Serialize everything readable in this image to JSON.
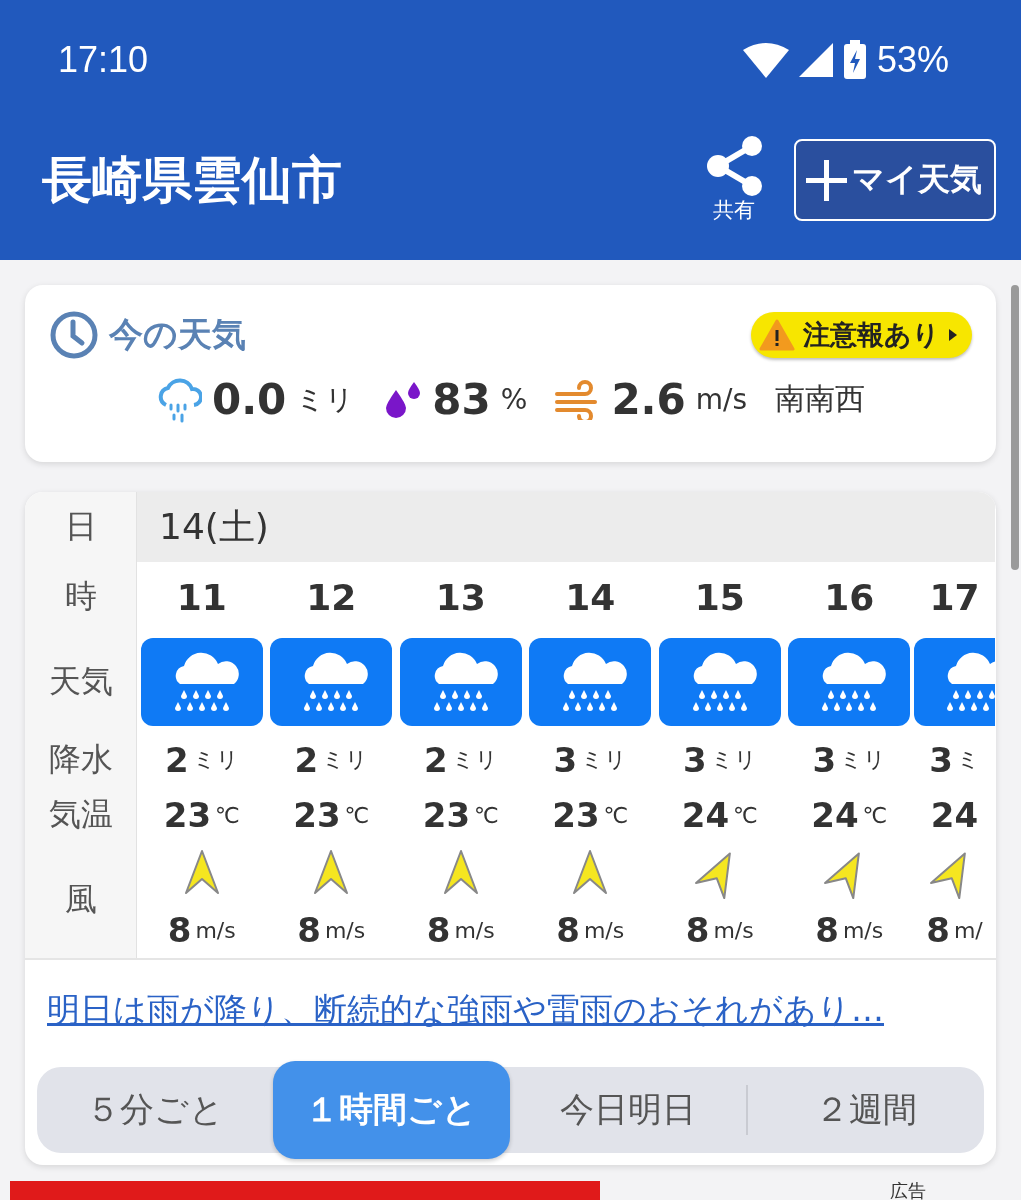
{
  "status_bar": {
    "time": "17:10",
    "battery": "53%"
  },
  "header": {
    "title": "長崎県雲仙市",
    "share_label": "共有",
    "my_weather_button": "マイ天気"
  },
  "current": {
    "title": "今の天気",
    "alert": "注意報あり",
    "precip": {
      "value": "0.0",
      "unit": "ミリ"
    },
    "humidity": {
      "value": "83",
      "unit": "%"
    },
    "wind": {
      "value": "2.6",
      "unit": "m/s",
      "direction": "南南西"
    }
  },
  "forecast": {
    "row_labels": [
      "日",
      "時",
      "天気",
      "降水",
      "気温",
      "風"
    ],
    "date": "14(土)",
    "hours": [
      {
        "hour": "11",
        "kind": "rain",
        "precip": "2",
        "precip_unit": "ミリ",
        "temp": "23",
        "temp_unit": "℃",
        "arrow_tilted": false,
        "wind": "8",
        "wind_unit": "m/s"
      },
      {
        "hour": "12",
        "kind": "rain",
        "precip": "2",
        "precip_unit": "ミリ",
        "temp": "23",
        "temp_unit": "℃",
        "arrow_tilted": false,
        "wind": "8",
        "wind_unit": "m/s"
      },
      {
        "hour": "13",
        "kind": "rain",
        "precip": "2",
        "precip_unit": "ミリ",
        "temp": "23",
        "temp_unit": "℃",
        "arrow_tilted": false,
        "wind": "8",
        "wind_unit": "m/s"
      },
      {
        "hour": "14",
        "kind": "rain",
        "precip": "3",
        "precip_unit": "ミリ",
        "temp": "23",
        "temp_unit": "℃",
        "arrow_tilted": false,
        "wind": "8",
        "wind_unit": "m/s"
      },
      {
        "hour": "15",
        "kind": "rain",
        "precip": "3",
        "precip_unit": "ミリ",
        "temp": "24",
        "temp_unit": "℃",
        "arrow_tilted": true,
        "wind": "8",
        "wind_unit": "m/s"
      },
      {
        "hour": "16",
        "kind": "rain",
        "precip": "3",
        "precip_unit": "ミリ",
        "temp": "24",
        "temp_unit": "℃",
        "arrow_tilted": true,
        "wind": "8",
        "wind_unit": "m/s"
      },
      {
        "hour": "17",
        "kind": "rain",
        "precip": "3",
        "precip_unit": "ミ",
        "temp": "24",
        "arrow_tilted": true,
        "wind": "8",
        "wind_unit": "m/"
      }
    ]
  },
  "summary_link": "明日は雨が降り、断続的な強雨や雷雨のおそれがあり…",
  "tabs": [
    {
      "label": "５分ごと",
      "selected": false
    },
    {
      "label": "１時間ごと",
      "selected": true
    },
    {
      "label": "今日明日",
      "selected": false
    },
    {
      "label": "２週間",
      "selected": false
    }
  ],
  "ad_label": "広告"
}
